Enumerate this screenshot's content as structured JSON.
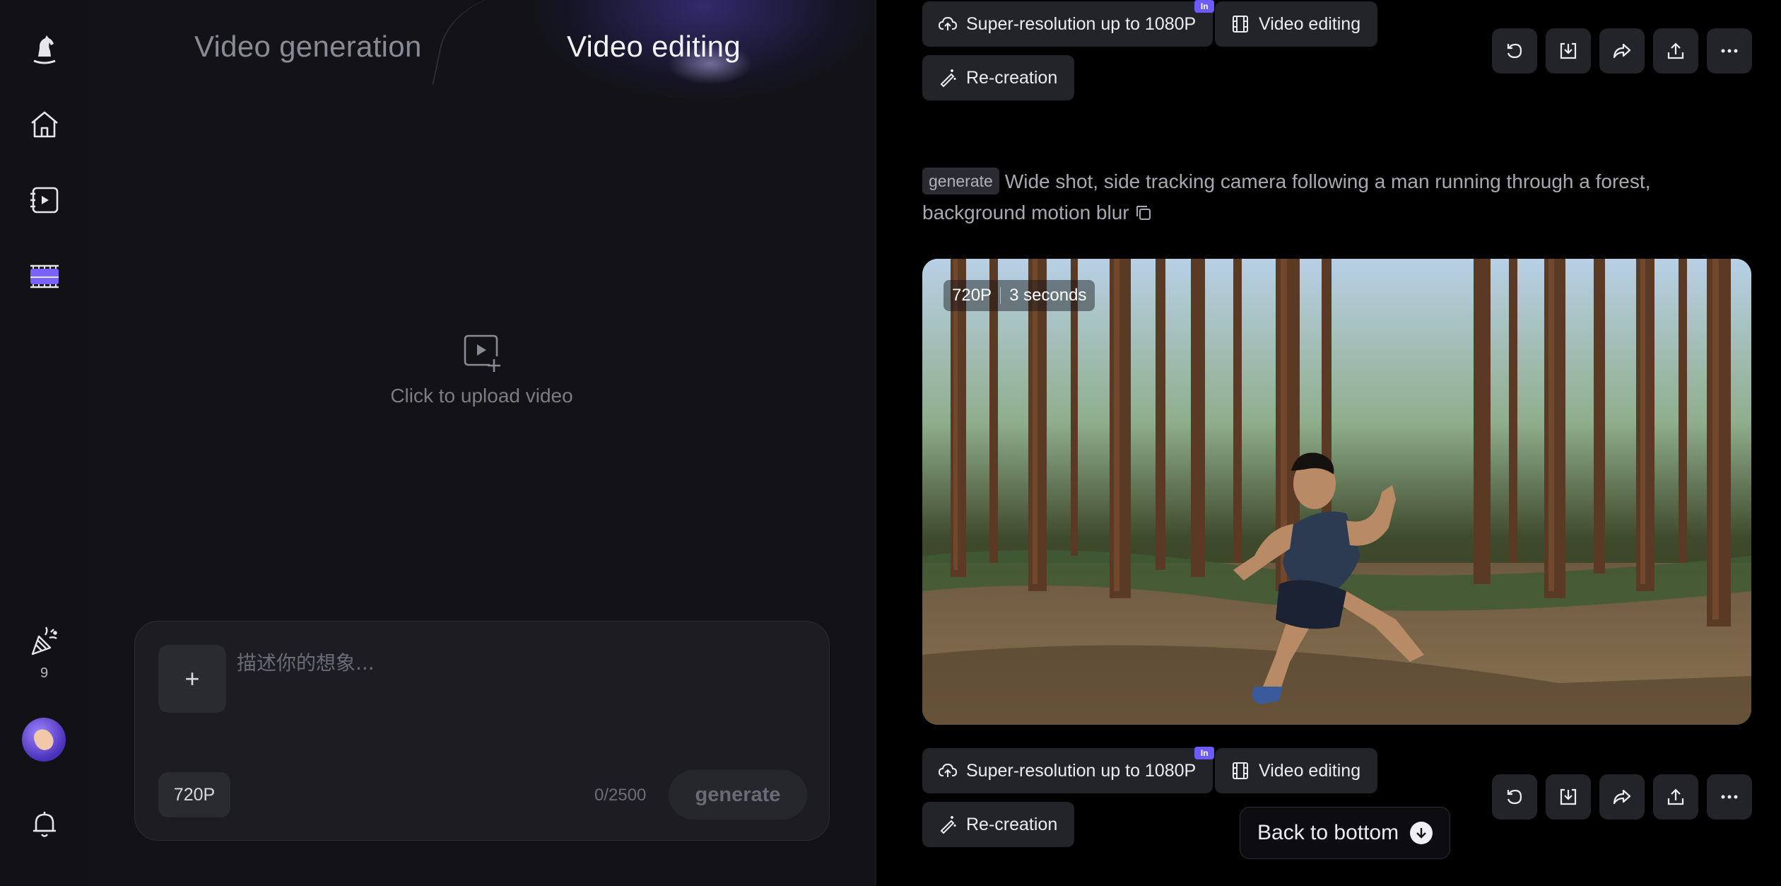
{
  "sidebar": {
    "items": [
      {
        "icon": "rocking-horse-logo-icon"
      },
      {
        "icon": "home-icon"
      },
      {
        "icon": "video-library-icon"
      },
      {
        "icon": "video-editor-icon"
      }
    ],
    "credits_icon": "party-popper-icon",
    "credits_count": "9",
    "avatar": "avatar",
    "notifications_icon": "bell-icon"
  },
  "left": {
    "tabs": [
      "Video generation",
      "Video editing"
    ],
    "active_tab": "Video editing",
    "upload": {
      "icon": "video-upload-icon",
      "label": "Click to upload video"
    },
    "composer": {
      "add_label": "+",
      "placeholder": "描述你的想象...",
      "value": "",
      "resolution": "720P",
      "char_count": "0/2500",
      "generate_label": "generate"
    }
  },
  "right": {
    "top_actions": {
      "super_res": "Super-resolution up to 1080P",
      "super_res_badge": "In",
      "video_editing": "Video editing",
      "recreation": "Re-creation",
      "icons": [
        "rotate-icon",
        "download-icon",
        "share-icon",
        "upload-icon",
        "more-icon"
      ]
    },
    "prompt": {
      "tag": "generate",
      "text": "Wide shot, side tracking camera following a man running through a forest, background motion blur"
    },
    "video": {
      "resolution": "720P",
      "duration": "3 seconds",
      "description": "man-running-through-forest"
    },
    "bottom_actions": {
      "super_res": "Super-resolution up to 1080P",
      "super_res_badge": "In",
      "video_editing": "Video editing",
      "recreation": "Re-creation"
    },
    "back_to_bottom": "Back to bottom"
  },
  "colors": {
    "accent": "#6e5bff",
    "panel_bg": "#131317",
    "sidebar_bg": "#121216",
    "chip_bg": "#23232a"
  }
}
